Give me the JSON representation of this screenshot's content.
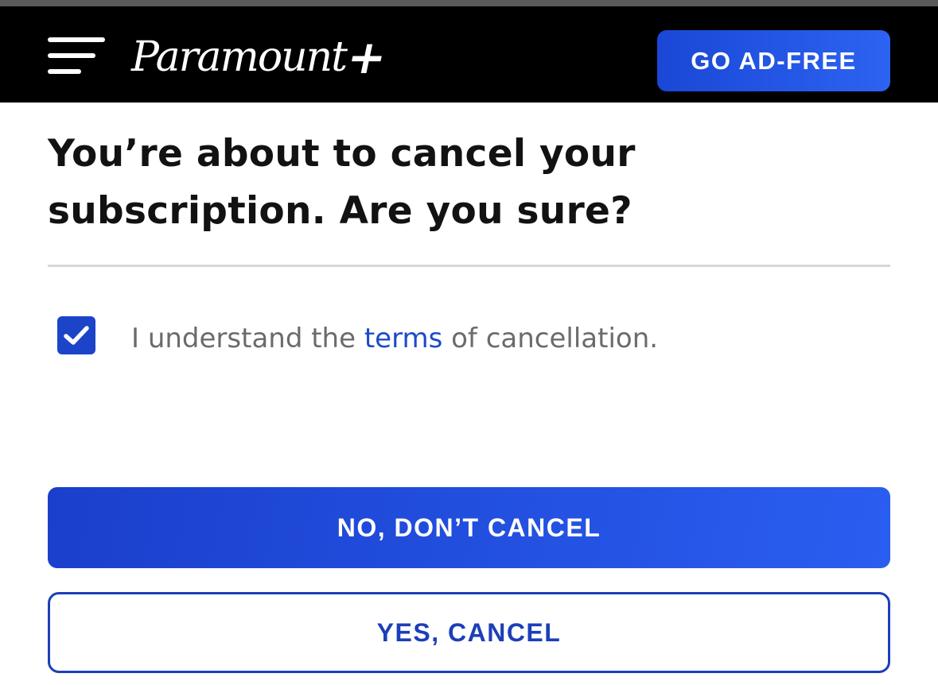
{
  "header": {
    "logo_text": "Paramount",
    "logo_plus": "+",
    "ad_free_label": "GO AD-FREE",
    "menu_icon": "hamburger-menu-icon"
  },
  "main": {
    "title_line1": "You’re about to cancel your",
    "title_line2": "subscription. Are you sure?",
    "checkbox_checked": true,
    "terms_prefix": "I understand the ",
    "terms_link": "terms",
    "terms_suffix": " of cancellation.",
    "no_cancel_label": "NO, DON’T CANCEL",
    "yes_cancel_label": "YES, CANCEL"
  },
  "colors": {
    "header_bg": "#000000",
    "accent": "#1c44c9",
    "link": "#1c4bc8",
    "body_text": "#121212",
    "muted_text": "#6b6b6b"
  }
}
